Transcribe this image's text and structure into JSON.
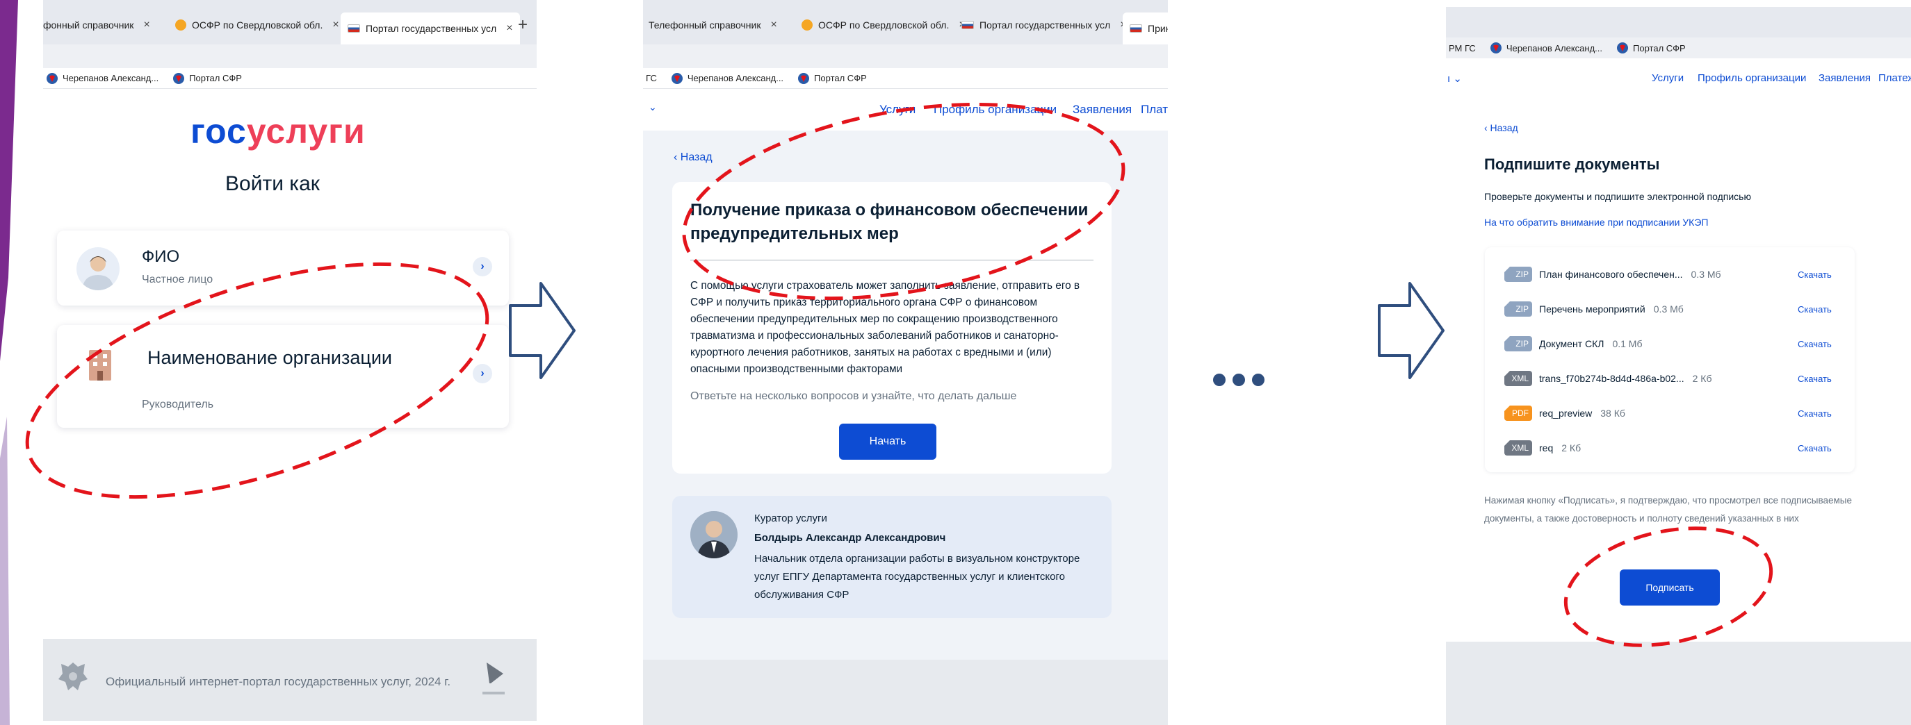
{
  "colors": {
    "accent_blue": "#0d4cd3",
    "logo_red": "#ee3f58",
    "annotation_red": "#e3141b",
    "arrow_stroke": "#2f4e7e",
    "zip_badge": "#8fa4c0",
    "xml_badge": "#6f7783",
    "pdf_badge": "#f7931e",
    "slide_accent": "#7b2a8e"
  },
  "panel1": {
    "tabs": [
      {
        "label": "фонный справочник",
        "close": "×"
      },
      {
        "label": "ОСФР по Свердловской обл.",
        "close": "×"
      },
      {
        "label": "Портал государственных усл",
        "close": "×"
      }
    ],
    "new_tab": "+",
    "bookmarks": [
      "Черепанов Александ...",
      "Портал СФР"
    ],
    "logo_gos": "гос",
    "logo_uslugi": "услуги",
    "login_as": "Войти как",
    "fio_label": "ФИО",
    "fio_sub": "Частное лицо",
    "org_label": "Наименование организации",
    "org_sub": "Руководитель",
    "chevron": "›",
    "footer_text": "Официальный интернет-портал государственных услуг, 2024 г."
  },
  "panel2": {
    "tabs": [
      {
        "label": "Телефонный справочник",
        "close": "×"
      },
      {
        "label": "ОСФР по Свердловской обл.",
        "close": "×"
      },
      {
        "label": "Портал государственных усл",
        "close": "×"
      },
      {
        "label": "Прин",
        "close": ""
      }
    ],
    "bookmarks_prefix": "ГС",
    "bookmarks": [
      "Черепанов Александ...",
      "Портал СФР"
    ],
    "nav_dropdown": "⌄",
    "nav": [
      "Услуги",
      "Профиль организации",
      "Заявления",
      "Плат"
    ],
    "back": "‹ Назад",
    "title": "Получение приказа о финансовом обеспечении предупредительных мер",
    "description": "С помощью услуги страхователь может заполнить заявление, отправить его в СФР и получить приказ территориального органа СФР о финансовом обеспечении предупредительных мер по сокращению производственного травматизма и профессиональных заболеваний работников и санаторно-курортного лечения работников, занятых на работах с вредными и (или) опасными производственными факторами",
    "hint": "Ответьте на несколько вопросов и узнайте, что делать дальше",
    "start_button": "Начать",
    "curator_label": "Куратор услуги",
    "curator_name": "Болдырь Александр Александрович",
    "curator_role": "Начальник отдела организации работы в визуальном конструкторе услуг ЕПГУ Департамента государственных услуг и клиентского обслуживания СФР"
  },
  "panel3": {
    "bookmarks_prefix": "РМ ГС",
    "bookmarks": [
      "Черепанов Александ...",
      "Портал СФР"
    ],
    "nav_left": "ı ⌄",
    "nav": [
      "Услуги",
      "Профиль организации",
      "Заявления",
      "Платеж"
    ],
    "back": "‹ Назад",
    "title": "Подпишите документы",
    "subtitle": "Проверьте документы и подпишите электронной подписью",
    "link": "На что обратить внимание при подписании УКЭП",
    "files": [
      {
        "type": "ZIP",
        "name": "План финансового обеспечен...",
        "size": "0.3 Мб",
        "action": "Скачать"
      },
      {
        "type": "ZIP",
        "name": "Перечень мероприятий",
        "size": "0.3 Мб",
        "action": "Скачать"
      },
      {
        "type": "ZIP",
        "name": "Документ СКЛ",
        "size": "0.1 Мб",
        "action": "Скачать"
      },
      {
        "type": "XML",
        "name": "trans_f70b274b-8d4d-486a-b02...",
        "size": "2 Кб",
        "action": "Скачать"
      },
      {
        "type": "PDF",
        "name": "req_preview",
        "size": "38 Кб",
        "action": "Скачать"
      },
      {
        "type": "XML",
        "name": "req",
        "size": "2 Кб",
        "action": "Скачать"
      }
    ],
    "disclaimer": "Нажимая кнопку «Подписать», я подтверждаю, что просмотрел все подписываемые документы, а также достоверность и полноту сведений указанных в них",
    "sign_button": "Подписать"
  }
}
